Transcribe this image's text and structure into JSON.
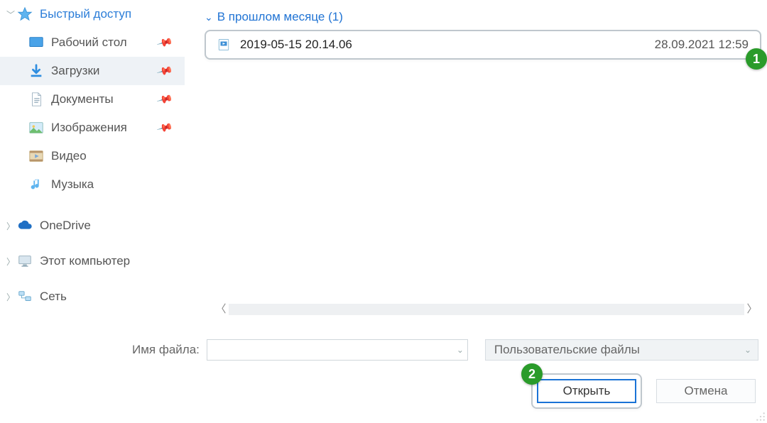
{
  "sidebar": {
    "quick_access": {
      "label": "Быстрый доступ"
    },
    "items": [
      {
        "label": "Рабочий стол",
        "pinned": true
      },
      {
        "label": "Загрузки",
        "pinned": true,
        "selected": true
      },
      {
        "label": "Документы",
        "pinned": true
      },
      {
        "label": "Изображения",
        "pinned": true
      },
      {
        "label": "Видео",
        "pinned": false
      },
      {
        "label": "Музыка",
        "pinned": false
      }
    ],
    "roots": [
      {
        "label": "OneDrive"
      },
      {
        "label": "Этот компьютер"
      },
      {
        "label": "Сеть"
      }
    ]
  },
  "content": {
    "group_label": "В прошлом месяце (1)",
    "files": [
      {
        "name": "2019-05-15 20.14.06",
        "date": "28.09.2021 12:59"
      }
    ]
  },
  "footer": {
    "filename_label": "Имя файла:",
    "filename_value": "",
    "filetype_label": "Пользовательские файлы",
    "open_label": "Открыть",
    "cancel_label": "Отмена"
  },
  "callouts": {
    "c1": "1",
    "c2": "2"
  }
}
